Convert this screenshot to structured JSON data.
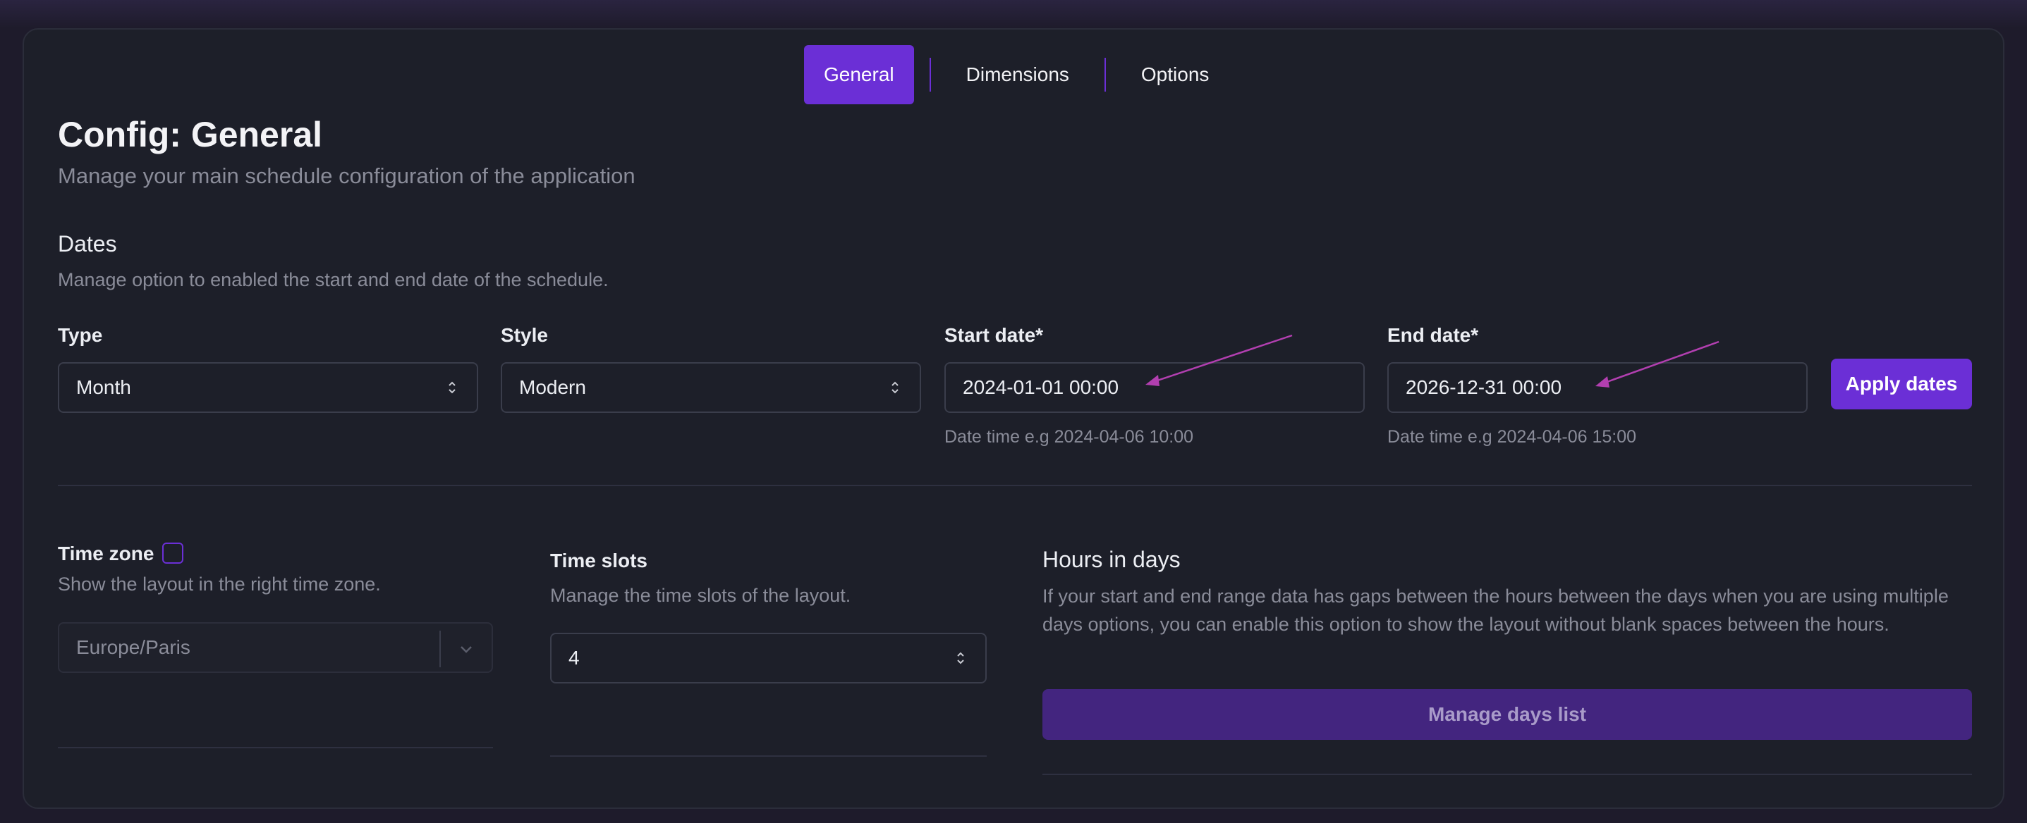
{
  "tabs": [
    {
      "label": "General",
      "active": true
    },
    {
      "label": "Dimensions",
      "active": false
    },
    {
      "label": "Options",
      "active": false
    }
  ],
  "page": {
    "title": "Config: General",
    "subtitle": "Manage your main schedule configuration of the application"
  },
  "dates": {
    "title": "Dates",
    "description": "Manage option to enabled the start and end date of the schedule.",
    "type": {
      "label": "Type",
      "value": "Month"
    },
    "style": {
      "label": "Style",
      "value": "Modern"
    },
    "start": {
      "label": "Start date*",
      "value": "2024-01-01 00:00",
      "hint": "Date time e.g 2024-04-06 10:00"
    },
    "end": {
      "label": "End date*",
      "value": "2026-12-31 00:00",
      "hint": "Date time e.g 2024-04-06 15:00"
    },
    "apply_label": "Apply dates"
  },
  "timezone": {
    "label": "Time zone",
    "enabled": false,
    "description": "Show the layout in the right time zone.",
    "value": "Europe/Paris"
  },
  "timeslots": {
    "title": "Time slots",
    "description": "Manage the time slots of the layout.",
    "value": "4"
  },
  "hours": {
    "title": "Hours in days",
    "description": "If your start and end range data has gaps between the hours between the days when you are using multiple days options, you can enable this option to show the layout without blank spaces between the hours.",
    "button_label": "Manage days list"
  },
  "colors": {
    "accent": "#6b2fd6",
    "accent_muted": "#43257f",
    "annotation_arrow": "#b23fb0",
    "background": "#1d1f29"
  }
}
